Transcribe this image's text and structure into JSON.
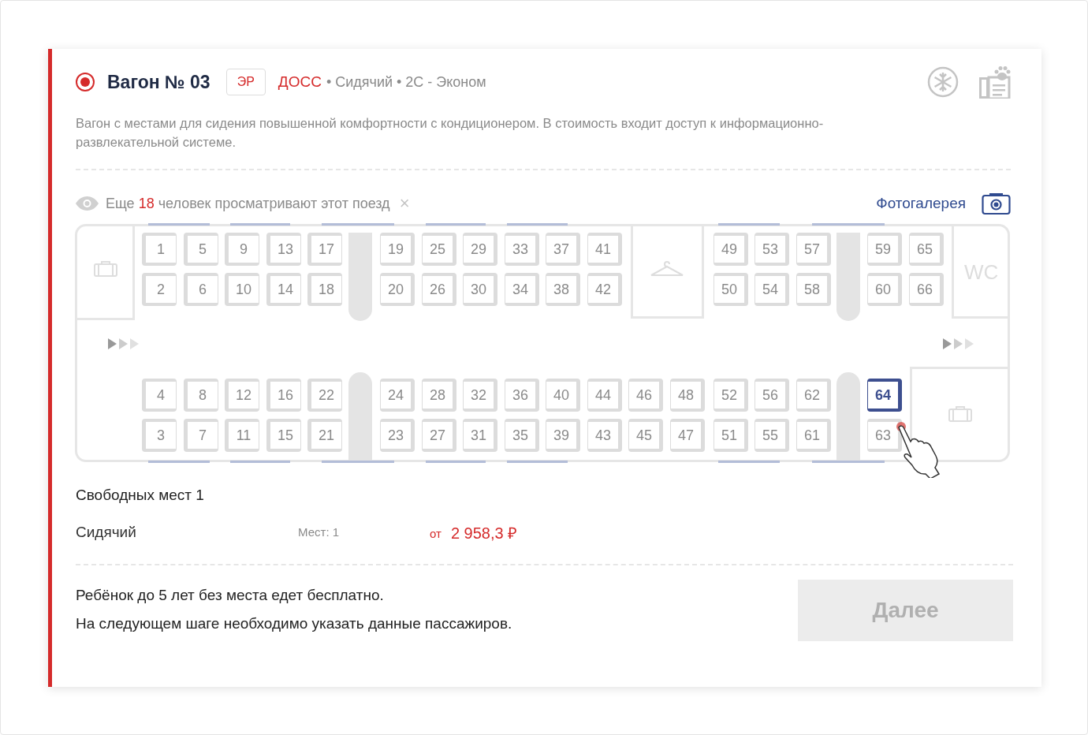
{
  "car": {
    "selected": true,
    "title": "Вагон № 03",
    "badge": "ЭР",
    "brand": "ДОСС",
    "details": "• Сидячий • 2С - Эконом"
  },
  "description": "Вагон с местами для сидения повышенной комфортности с кондиционером. В стоимость входит доступ к информационно-развлекательной системе.",
  "viewers": {
    "before": "Еще",
    "count": "18",
    "after": "человек просматривают этот поезд",
    "close": "×"
  },
  "gallery_link": "Фотогалерея",
  "seat_map": {
    "wc_label": "WC",
    "upper_row_1": [
      {
        "number": "1",
        "selected": false
      },
      {
        "number": "5",
        "selected": false
      },
      {
        "number": "9",
        "selected": false
      },
      {
        "number": "13",
        "selected": false
      },
      {
        "number": "17",
        "selected": false
      },
      {
        "number": "19",
        "selected": false
      },
      {
        "number": "25",
        "selected": false
      },
      {
        "number": "29",
        "selected": false
      },
      {
        "number": "33",
        "selected": false
      },
      {
        "number": "37",
        "selected": false
      },
      {
        "number": "41",
        "selected": false
      },
      {
        "number": "49",
        "selected": false
      },
      {
        "number": "53",
        "selected": false
      },
      {
        "number": "57",
        "selected": false
      },
      {
        "number": "59",
        "selected": false
      },
      {
        "number": "65",
        "selected": false
      }
    ],
    "upper_row_2": [
      {
        "number": "2",
        "selected": false
      },
      {
        "number": "6",
        "selected": false
      },
      {
        "number": "10",
        "selected": false
      },
      {
        "number": "14",
        "selected": false
      },
      {
        "number": "18",
        "selected": false
      },
      {
        "number": "20",
        "selected": false
      },
      {
        "number": "26",
        "selected": false
      },
      {
        "number": "30",
        "selected": false
      },
      {
        "number": "34",
        "selected": false
      },
      {
        "number": "38",
        "selected": false
      },
      {
        "number": "42",
        "selected": false
      },
      {
        "number": "50",
        "selected": false
      },
      {
        "number": "54",
        "selected": false
      },
      {
        "number": "58",
        "selected": false
      },
      {
        "number": "60",
        "selected": false
      },
      {
        "number": "66",
        "selected": false
      }
    ],
    "lower_row_1": [
      {
        "number": "4",
        "selected": false
      },
      {
        "number": "8",
        "selected": false
      },
      {
        "number": "12",
        "selected": false
      },
      {
        "number": "16",
        "selected": false
      },
      {
        "number": "22",
        "selected": false
      },
      {
        "number": "24",
        "selected": false
      },
      {
        "number": "28",
        "selected": false
      },
      {
        "number": "32",
        "selected": false
      },
      {
        "number": "36",
        "selected": false
      },
      {
        "number": "40",
        "selected": false
      },
      {
        "number": "44",
        "selected": false
      },
      {
        "number": "46",
        "selected": false
      },
      {
        "number": "48",
        "selected": false
      },
      {
        "number": "52",
        "selected": false
      },
      {
        "number": "56",
        "selected": false
      },
      {
        "number": "62",
        "selected": false
      },
      {
        "number": "64",
        "selected": true
      }
    ],
    "lower_row_2": [
      {
        "number": "3",
        "selected": false
      },
      {
        "number": "7",
        "selected": false
      },
      {
        "number": "11",
        "selected": false
      },
      {
        "number": "15",
        "selected": false
      },
      {
        "number": "21",
        "selected": false
      },
      {
        "number": "23",
        "selected": false
      },
      {
        "number": "27",
        "selected": false
      },
      {
        "number": "31",
        "selected": false
      },
      {
        "number": "35",
        "selected": false
      },
      {
        "number": "39",
        "selected": false
      },
      {
        "number": "43",
        "selected": false
      },
      {
        "number": "45",
        "selected": false
      },
      {
        "number": "47",
        "selected": false
      },
      {
        "number": "51",
        "selected": false
      },
      {
        "number": "55",
        "selected": false
      },
      {
        "number": "61",
        "selected": false
      },
      {
        "number": "63",
        "selected": false
      }
    ]
  },
  "free_seats": "Свободных мест 1",
  "offer": {
    "type": "Сидячий",
    "seats": "Мест: 1",
    "price_prefix": "от",
    "price": "2 958,3 ₽"
  },
  "notes": [
    "Ребёнок до 5 лет без места едет бесплатно.",
    "На следующем шаге необходимо указать данные пассажиров."
  ],
  "next_button": {
    "label": "Далее",
    "disabled": true
  }
}
